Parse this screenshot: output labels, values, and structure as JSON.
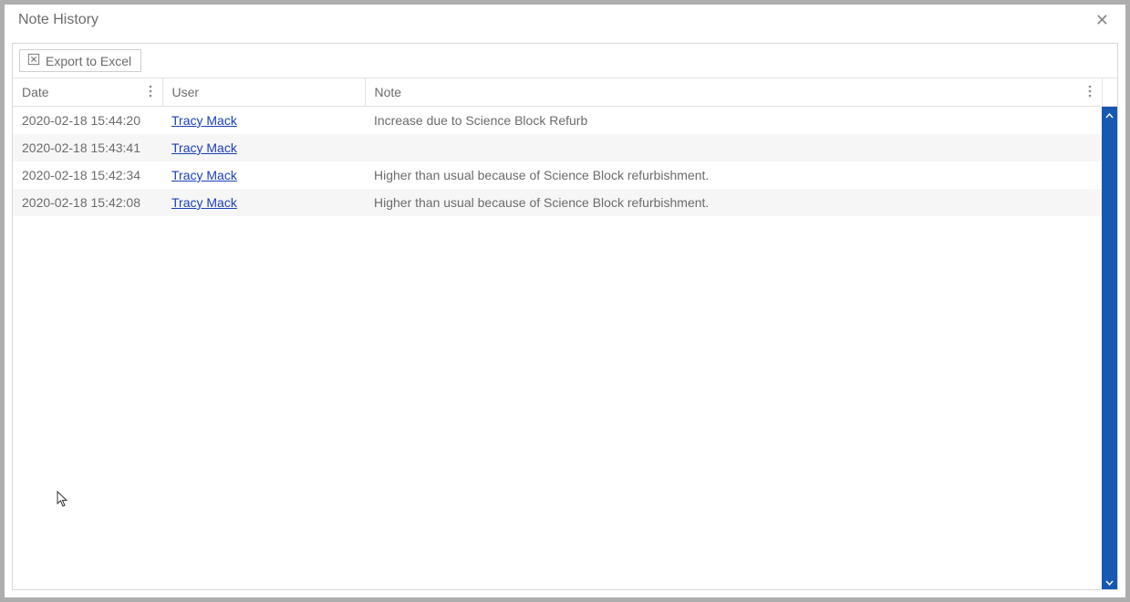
{
  "modal": {
    "title": "Note History"
  },
  "toolbar": {
    "export_label": "Export to Excel"
  },
  "columns": {
    "date": "Date",
    "user": "User",
    "note": "Note"
  },
  "rows": [
    {
      "date": "2020-02-18 15:44:20",
      "user": "Tracy Mack",
      "note": "Increase due to Science Block Refurb"
    },
    {
      "date": "2020-02-18 15:43:41",
      "user": "Tracy Mack",
      "note": ""
    },
    {
      "date": "2020-02-18 15:42:34",
      "user": "Tracy Mack",
      "note": "Higher than usual because of Science Block refurbishment."
    },
    {
      "date": "2020-02-18 15:42:08",
      "user": "Tracy Mack",
      "note": "Higher than usual because of Science Block refurbishment."
    }
  ]
}
